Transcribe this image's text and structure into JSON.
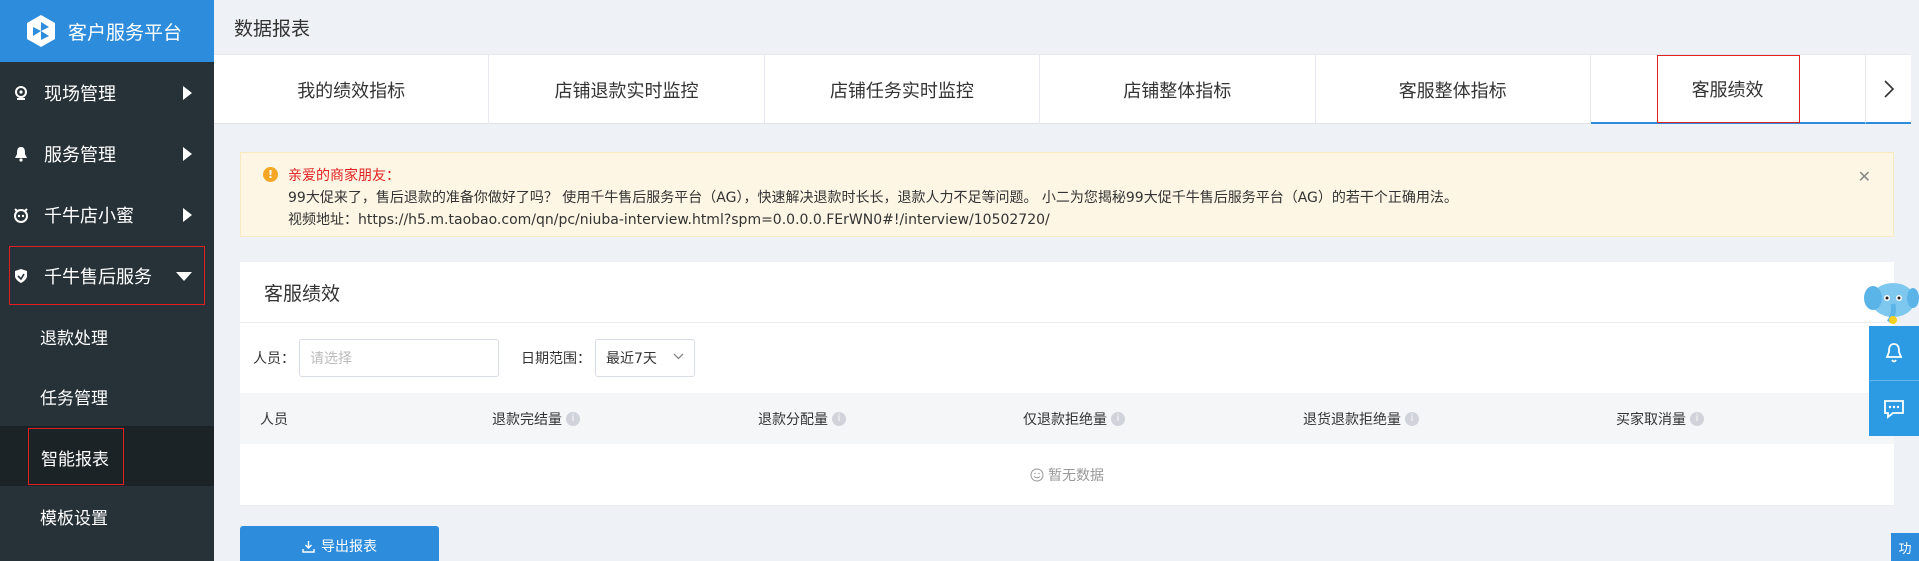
{
  "brand": {
    "title": "客户服务平台"
  },
  "sidebar": {
    "items": [
      {
        "label": "现场管理"
      },
      {
        "label": "服务管理"
      },
      {
        "label": "千牛店小蜜"
      },
      {
        "label": "千牛售后服务"
      }
    ],
    "submenu": [
      {
        "label": "退款处理"
      },
      {
        "label": "任务管理"
      },
      {
        "label": "智能报表"
      },
      {
        "label": "模板设置"
      }
    ]
  },
  "page": {
    "title": "数据报表"
  },
  "tabs": [
    {
      "label": "我的绩效指标"
    },
    {
      "label": "店铺退款实时监控"
    },
    {
      "label": "店铺任务实时监控"
    },
    {
      "label": "店铺整体指标"
    },
    {
      "label": "客服整体指标"
    },
    {
      "label": "客服绩效"
    }
  ],
  "notice": {
    "heading": "亲爱的商家朋友：",
    "line1": "99大促来了，售后退款的准备你做好了吗？ 使用千牛售后服务平台（AG），快速解决退款时长长，退款人力不足等问题。 小二为您揭秘99大促千牛售后服务平台（AG）的若干个正确用法。",
    "line2": "视频地址：https://h5.m.taobao.com/qn/pc/niuba-interview.html?spm=0.0.0.0.FErWN0#!/interview/10502720/"
  },
  "panel": {
    "title": "客服绩效",
    "filters": {
      "person_label": "人员：",
      "person_placeholder": "请选择",
      "date_label": "日期范围：",
      "date_value": "最近7天"
    },
    "columns": [
      "人员",
      "退款完结量",
      "退款分配量",
      "仅退款拒绝量",
      "退货退款拒绝量",
      "买家取消量"
    ],
    "empty_text": "暂无数据"
  },
  "export": {
    "label": "导出报表"
  },
  "corner": {
    "label": "功"
  },
  "colors": {
    "sidebar": "#263238",
    "accent": "#2d8ddc",
    "highlight": "#e02020",
    "notice_bg": "#fdf6e4"
  }
}
